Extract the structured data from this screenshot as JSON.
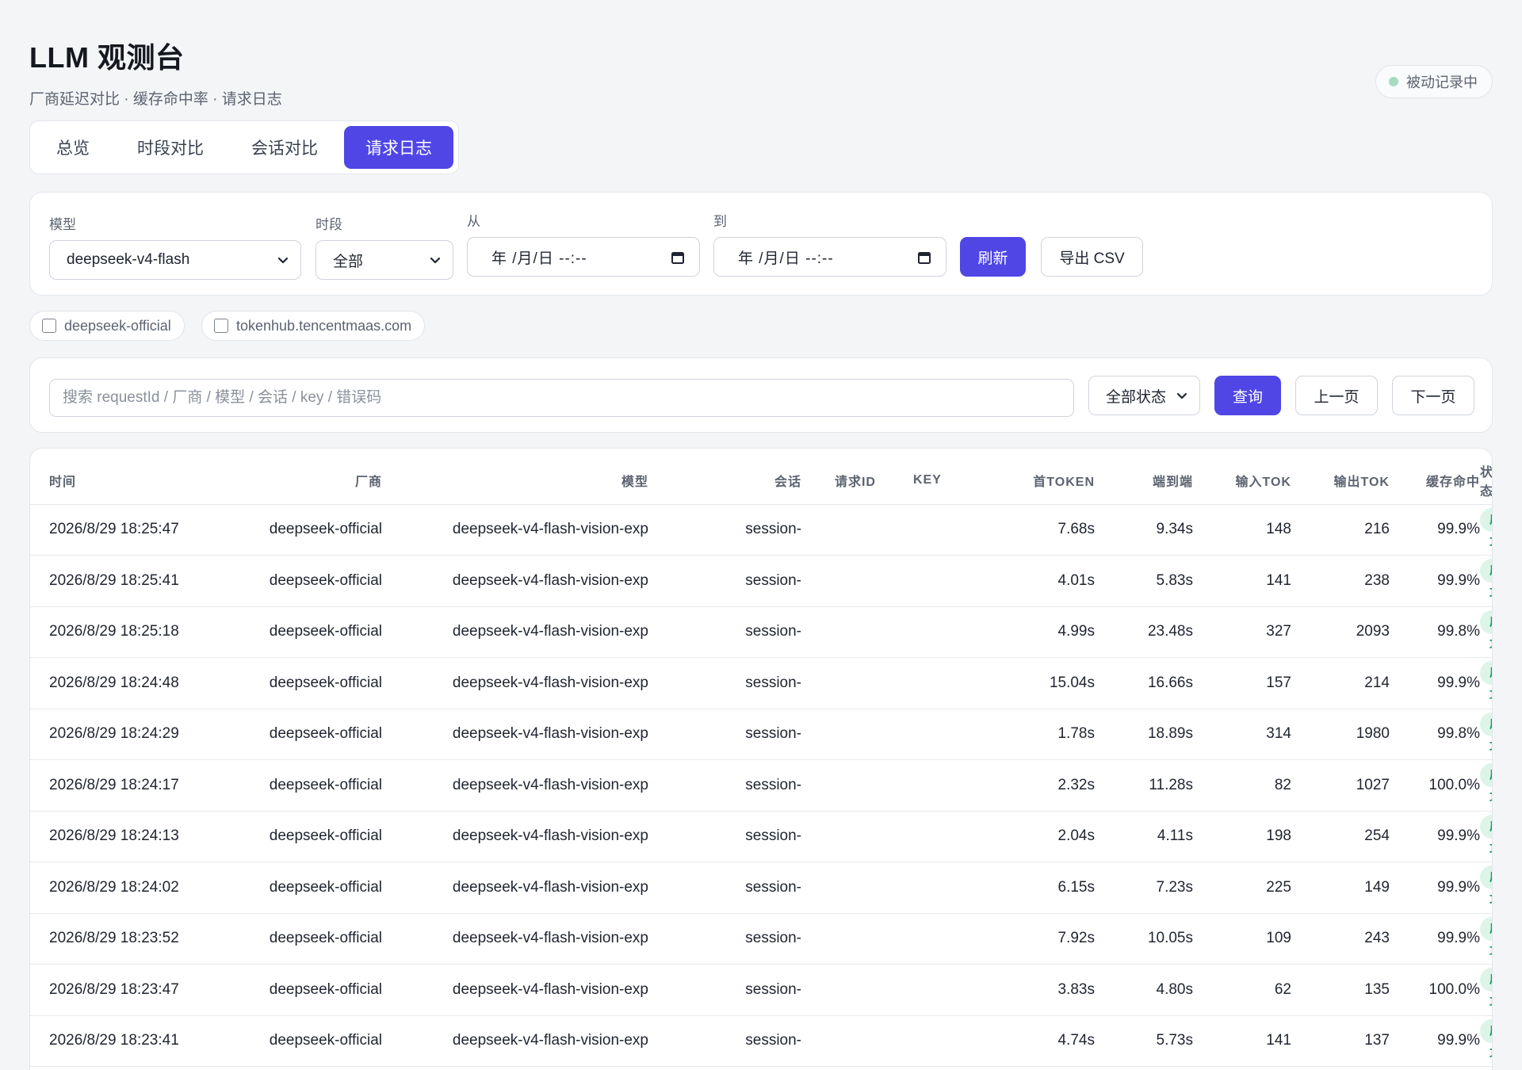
{
  "header": {
    "title": "LLM 观测台",
    "subtitle": "厂商延迟对比 · 缓存命中率 · 请求日志",
    "status_badge": "被动记录中"
  },
  "tabs": [
    {
      "label": "总览"
    },
    {
      "label": "时段对比"
    },
    {
      "label": "会话对比"
    },
    {
      "label": "请求日志",
      "active": true
    }
  ],
  "filters": {
    "model_label": "模型",
    "model_value": "deepseek-v4-flash",
    "period_label": "时段",
    "period_value": "全部",
    "from_label": "从",
    "from_value": "年 /月/日 --:--",
    "to_label": "到",
    "to_value": "年 /月/日 --:--",
    "refresh_label": "刷新",
    "export_label": "导出 CSV"
  },
  "vendor_chips": [
    {
      "label": "deepseek-official",
      "checked": false
    },
    {
      "label": "tokenhub.tencentmaas.com",
      "checked": false
    }
  ],
  "search": {
    "placeholder": "搜索 requestId / 厂商 / 模型 / 会话 / key / 错误码",
    "status_value": "全部状态",
    "query_label": "查询",
    "prev_label": "上一页",
    "next_label": "下一页"
  },
  "table": {
    "columns": [
      "时间",
      "厂商",
      "模型",
      "会话",
      "请求ID",
      "KEY",
      "首TOKEN",
      "端到端",
      "输入TOK",
      "输出TOK",
      "缓存命中",
      "状态"
    ],
    "rows": [
      [
        "2026/8/29 18:25:47",
        "deepseek-official",
        "deepseek-v4-flash-vision-exp",
        "session-",
        "",
        "",
        "7.68s",
        "9.34s",
        "148",
        "216",
        "99.9%",
        "成功"
      ],
      [
        "2026/8/29 18:25:41",
        "deepseek-official",
        "deepseek-v4-flash-vision-exp",
        "session-",
        "",
        "",
        "4.01s",
        "5.83s",
        "141",
        "238",
        "99.9%",
        "成功"
      ],
      [
        "2026/8/29 18:25:18",
        "deepseek-official",
        "deepseek-v4-flash-vision-exp",
        "session-",
        "",
        "",
        "4.99s",
        "23.48s",
        "327",
        "2093",
        "99.8%",
        "成功"
      ],
      [
        "2026/8/29 18:24:48",
        "deepseek-official",
        "deepseek-v4-flash-vision-exp",
        "session-",
        "",
        "",
        "15.04s",
        "16.66s",
        "157",
        "214",
        "99.9%",
        "成功"
      ],
      [
        "2026/8/29 18:24:29",
        "deepseek-official",
        "deepseek-v4-flash-vision-exp",
        "session-",
        "",
        "",
        "1.78s",
        "18.89s",
        "314",
        "1980",
        "99.8%",
        "成功"
      ],
      [
        "2026/8/29 18:24:17",
        "deepseek-official",
        "deepseek-v4-flash-vision-exp",
        "session-",
        "",
        "",
        "2.32s",
        "11.28s",
        "82",
        "1027",
        "100.0%",
        "成功"
      ],
      [
        "2026/8/29 18:24:13",
        "deepseek-official",
        "deepseek-v4-flash-vision-exp",
        "session-",
        "",
        "",
        "2.04s",
        "4.11s",
        "198",
        "254",
        "99.9%",
        "成功"
      ],
      [
        "2026/8/29 18:24:02",
        "deepseek-official",
        "deepseek-v4-flash-vision-exp",
        "session-",
        "",
        "",
        "6.15s",
        "7.23s",
        "225",
        "149",
        "99.9%",
        "成功"
      ],
      [
        "2026/8/29 18:23:52",
        "deepseek-official",
        "deepseek-v4-flash-vision-exp",
        "session-",
        "",
        "",
        "7.92s",
        "10.05s",
        "109",
        "243",
        "99.9%",
        "成功"
      ],
      [
        "2026/8/29 18:23:47",
        "deepseek-official",
        "deepseek-v4-flash-vision-exp",
        "session-",
        "",
        "",
        "3.83s",
        "4.80s",
        "62",
        "135",
        "100.0%",
        "成功"
      ],
      [
        "2026/8/29 18:23:41",
        "deepseek-official",
        "deepseek-v4-flash-vision-exp",
        "session-",
        "",
        "",
        "4.74s",
        "5.73s",
        "141",
        "137",
        "99.9%",
        "成功"
      ]
    ]
  },
  "colors": {
    "accent": "#4f46e5",
    "success_bg": "#dcf5e8",
    "success_text": "#12a15a",
    "recording_dot": "#a6dcc0"
  },
  "icons": {
    "select_arrow": "chevron-down-icon",
    "date_picker": "calendar-icon",
    "checkbox": "checkbox-icon",
    "recording": "status-dot-icon"
  }
}
